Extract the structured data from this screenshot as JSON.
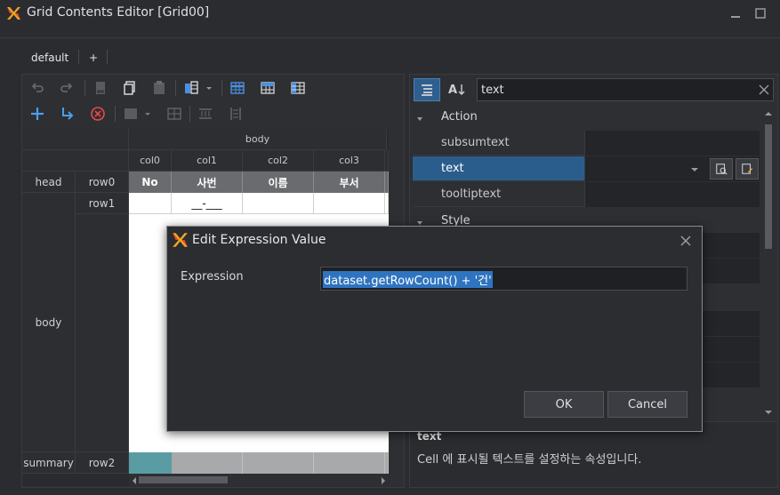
{
  "window": {
    "title": "Grid Contents Editor [Grid00]"
  },
  "tabs": [
    {
      "label": "default"
    },
    {
      "label": "+"
    }
  ],
  "grid": {
    "band_body": "body",
    "columns": [
      "col0",
      "col1",
      "col2",
      "col3"
    ],
    "bands": {
      "head": "head",
      "body": "body",
      "summary": "summary"
    },
    "rows": {
      "row0": "row0",
      "row1": "row1",
      "row2": "row2"
    },
    "head_cells": [
      "No",
      "사번",
      "이름",
      "부서"
    ],
    "body_cells": [
      "",
      "__-___",
      "",
      ""
    ]
  },
  "properties": {
    "search_value": "text",
    "categories": {
      "action": "Action",
      "style": "Style"
    },
    "items": [
      {
        "name": "subsumtext",
        "value": ""
      },
      {
        "name": "text",
        "value": ""
      },
      {
        "name": "tooltiptext",
        "value": ""
      }
    ],
    "description_title": "text",
    "description_text": "Cell 에 표시될 텍스트를 설정하는 속성입니다."
  },
  "dialog": {
    "title": "Edit Expression Value",
    "field_label": "Expression",
    "field_value": "dataset.getRowCount() + '건'",
    "ok_label": "OK",
    "cancel_label": "Cancel"
  },
  "colors": {
    "accent_blue": "#2f5f8f",
    "selection": "#2b5d8c",
    "logo_red": "#e84a2c",
    "logo_orange": "#f5a623",
    "summary_teal": "#5a9ca3"
  }
}
